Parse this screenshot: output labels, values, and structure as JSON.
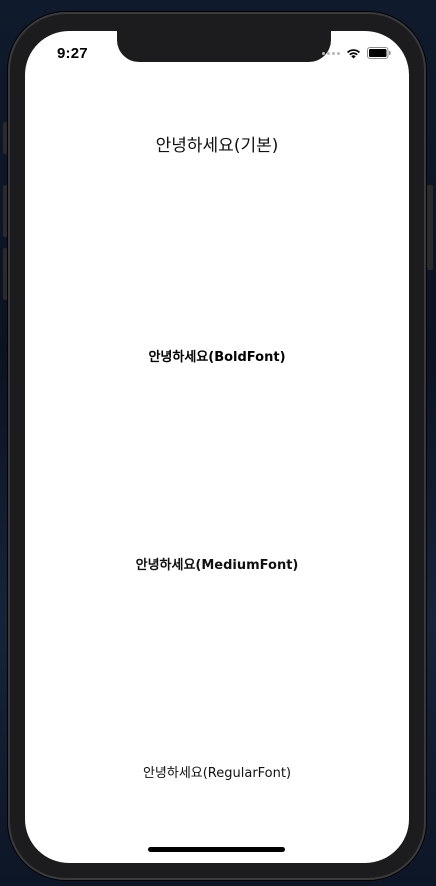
{
  "status_bar": {
    "time": "9:27",
    "icons": [
      "signal-dots-icon",
      "wifi-icon",
      "battery-icon"
    ]
  },
  "content": {
    "label_default": "안녕하세요(기본)",
    "label_bold": "안녕하세요(BoldFont)",
    "label_medium": "안녕하세요(MediumFont)",
    "label_regular": "안녕하세요(RegularFont)"
  },
  "colors": {
    "screen_background": "#ffffff",
    "device_frame": "#1c1c1e",
    "text": "#000000"
  }
}
